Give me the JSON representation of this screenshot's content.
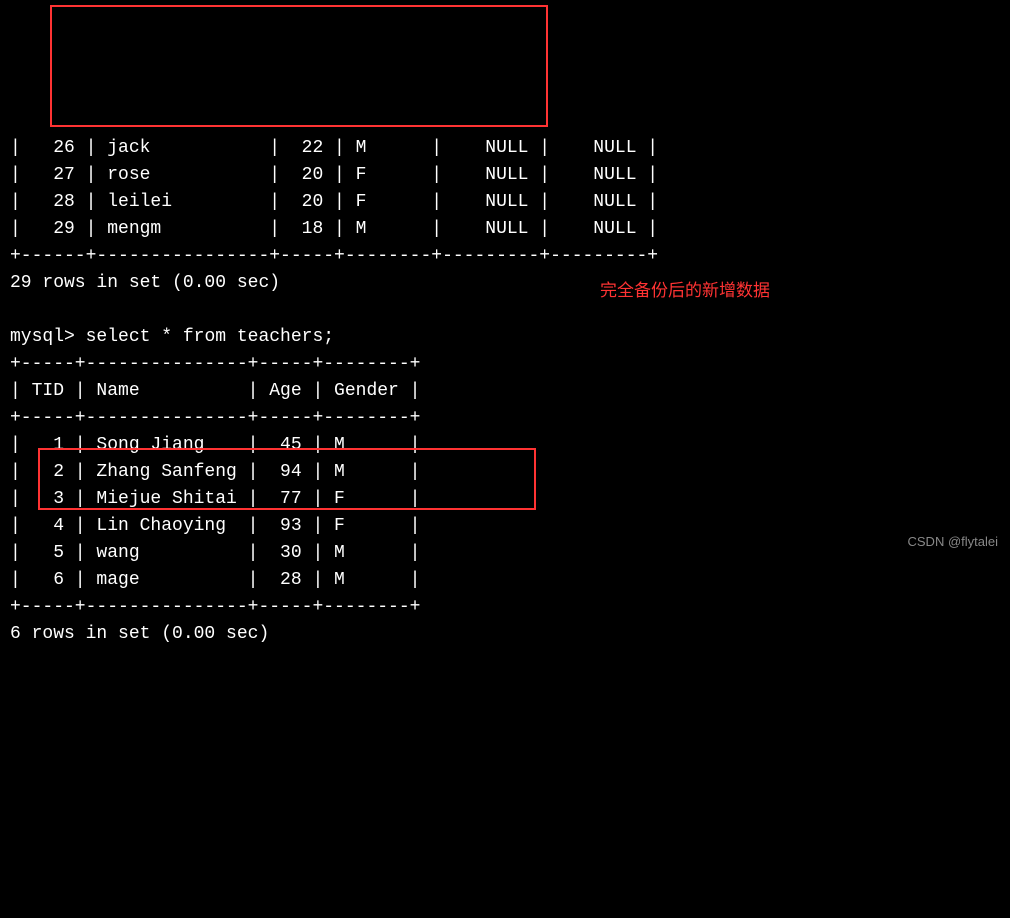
{
  "top_rows": [
    {
      "id": "26",
      "name": "jack",
      "age": "22",
      "gender": "M",
      "c5": "NULL",
      "c6": "NULL"
    },
    {
      "id": "27",
      "name": "rose",
      "age": "20",
      "gender": "F",
      "c5": "NULL",
      "c6": "NULL"
    },
    {
      "id": "28",
      "name": "leilei",
      "age": "20",
      "gender": "F",
      "c5": "NULL",
      "c6": "NULL"
    },
    {
      "id": "29",
      "name": "mengm",
      "age": "18",
      "gender": "M",
      "c5": "NULL",
      "c6": "NULL"
    }
  ],
  "top_sep": "+------+----------------+-----+--------+---------+---------+",
  "top_result": "29 rows in set (0.00 sec)",
  "prompt": "mysql> ",
  "query": "select * from teachers;",
  "teachers_sep": "+-----+---------------+-----+--------+",
  "teachers_header": {
    "tid": "TID",
    "name": "Name",
    "age": "Age",
    "gender": "Gender"
  },
  "teachers_rows": [
    {
      "tid": "1",
      "name": "Song Jiang",
      "age": "45",
      "gender": "M"
    },
    {
      "tid": "2",
      "name": "Zhang Sanfeng",
      "age": "94",
      "gender": "M"
    },
    {
      "tid": "3",
      "name": "Miejue Shitai",
      "age": "77",
      "gender": "F"
    },
    {
      "tid": "4",
      "name": "Lin Chaoying",
      "age": "93",
      "gender": "F"
    },
    {
      "tid": "5",
      "name": "wang",
      "age": "30",
      "gender": "M"
    },
    {
      "tid": "6",
      "name": "mage",
      "age": "28",
      "gender": "M"
    }
  ],
  "teachers_result": "6 rows in set (0.00 sec)",
  "annotation": "完全备份后的新增数据",
  "watermark": "CSDN @flytalei"
}
